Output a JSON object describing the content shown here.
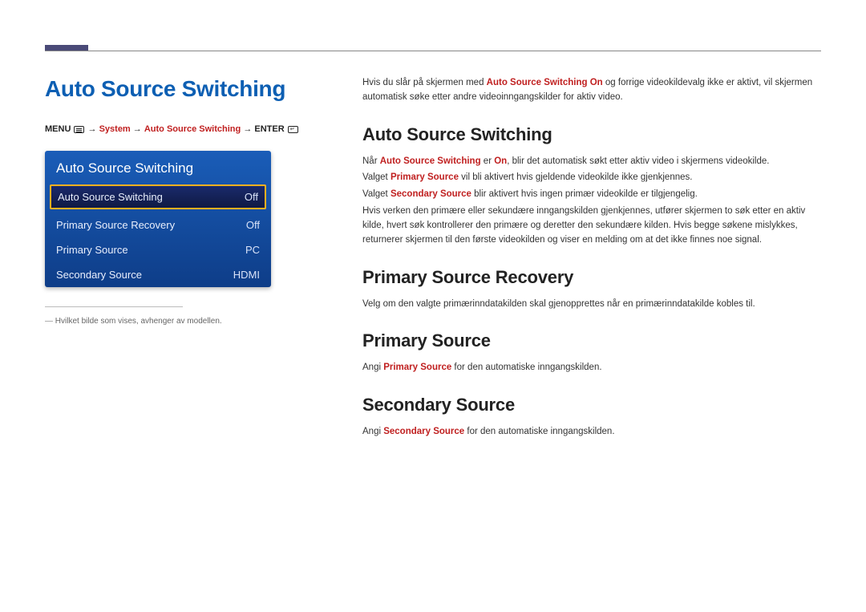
{
  "page": {
    "title": "Auto Source Switching",
    "breadcrumb": {
      "menu": "MENU",
      "part1": "System",
      "part2": "Auto Source Switching",
      "enter": "ENTER"
    }
  },
  "panel": {
    "title": "Auto Source Switching",
    "rows": [
      {
        "label": "Auto Source Switching",
        "value": "Off",
        "selected": true
      },
      {
        "label": "Primary Source Recovery",
        "value": "Off",
        "selected": false
      },
      {
        "label": "Primary Source",
        "value": "PC",
        "selected": false
      },
      {
        "label": "Secondary Source",
        "value": "HDMI",
        "selected": false
      }
    ]
  },
  "footnote": "Hvilket bilde som vises, avhenger av modellen.",
  "intro": {
    "p1a": "Hvis du slår på skjermen med ",
    "p1k": "Auto Source Switching On",
    "p1b": " og forrige videokildevalg ikke er aktivt, vil skjermen automatisk søke etter andre videoinngangskilder for aktiv video."
  },
  "sections": {
    "ass": {
      "heading": "Auto Source Switching",
      "p1a": "Når ",
      "p1k1": "Auto Source Switching",
      "p1b": " er ",
      "p1k2": "On",
      "p1c": ", blir det automatisk søkt etter aktiv video i skjermens videokilde.",
      "p2a": "Valget ",
      "p2k": "Primary Source",
      "p2b": " vil bli aktivert hvis gjeldende videokilde ikke gjenkjennes.",
      "p3a": "Valget ",
      "p3k": "Secondary Source",
      "p3b": " blir aktivert hvis ingen primær videokilde er tilgjengelig.",
      "p4": "Hvis verken den primære eller sekundære inngangskilden gjenkjennes, utfører skjermen to søk etter en aktiv kilde, hvert søk kontrollerer den primære og deretter den sekundære kilden. Hvis begge søkene mislykkes, returnerer skjermen til den første videokilden og viser en melding om at det ikke finnes noe signal."
    },
    "psr": {
      "heading": "Primary Source Recovery",
      "p1": "Velg om den valgte primærinndatakilden skal gjenopprettes når en primærinndatakilde kobles til."
    },
    "ps": {
      "heading": "Primary Source",
      "p1a": "Angi ",
      "p1k": "Primary Source",
      "p1b": " for den automatiske inngangskilden."
    },
    "ss": {
      "heading": "Secondary Source",
      "p1a": "Angi ",
      "p1k": "Secondary Source",
      "p1b": " for den automatiske inngangskilden."
    }
  }
}
